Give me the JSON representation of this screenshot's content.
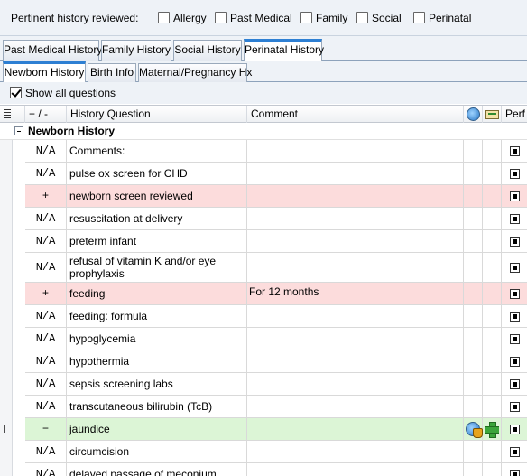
{
  "review": {
    "label": "Pertinent history reviewed:",
    "options": [
      "Allergy",
      "Past Medical",
      "Family",
      "Social",
      "Perinatal"
    ]
  },
  "main_tabs": [
    "Past Medical History",
    "Family History",
    "Social History",
    "Perinatal History"
  ],
  "sub_tabs": [
    "Newborn History",
    "Birth Info",
    "Maternal/Pregnancy Hx"
  ],
  "show_all_label": "Show all questions",
  "grid": {
    "headers": {
      "status": "+ / -",
      "question": "History Question",
      "comment": "Comment",
      "perf": "Perf"
    },
    "group_title": "Newborn History",
    "rows": [
      {
        "status": "N/A",
        "question": "Comments:",
        "comment": "",
        "highlight": "none"
      },
      {
        "status": "N/A",
        "question": "pulse ox screen for CHD",
        "comment": "",
        "highlight": "none"
      },
      {
        "status": "+",
        "question": "newborn screen reviewed",
        "comment": "",
        "highlight": "pink"
      },
      {
        "status": "N/A",
        "question": "resuscitation at delivery",
        "comment": "",
        "highlight": "none"
      },
      {
        "status": "N/A",
        "question": "preterm infant",
        "comment": "",
        "highlight": "none"
      },
      {
        "status": "N/A",
        "question": "refusal of vitamin K and/or eye prophylaxis",
        "comment": "",
        "highlight": "none"
      },
      {
        "status": "+",
        "question": "feeding",
        "comment": "For 12 months",
        "highlight": "pink"
      },
      {
        "status": "N/A",
        "question": "feeding: formula",
        "comment": "",
        "highlight": "none"
      },
      {
        "status": "N/A",
        "question": "hypoglycemia",
        "comment": "",
        "highlight": "none"
      },
      {
        "status": "N/A",
        "question": "hypothermia",
        "comment": "",
        "highlight": "none"
      },
      {
        "status": "N/A",
        "question": "sepsis screening labs",
        "comment": "",
        "highlight": "none"
      },
      {
        "status": "N/A",
        "question": "transcutaneous bilirubin (TcB)",
        "comment": "",
        "highlight": "none"
      },
      {
        "status": "−",
        "question": "jaundice",
        "comment": "",
        "highlight": "green"
      },
      {
        "status": "N/A",
        "question": "circumcision",
        "comment": "",
        "highlight": "none"
      },
      {
        "status": "N/A",
        "question": "delayed passage of meconium",
        "comment": "",
        "highlight": "none"
      }
    ]
  },
  "colors": {
    "pink_row": "#fcdcdc",
    "green_row": "#dcf5d6",
    "tab_accent": "#2d7fd3"
  }
}
